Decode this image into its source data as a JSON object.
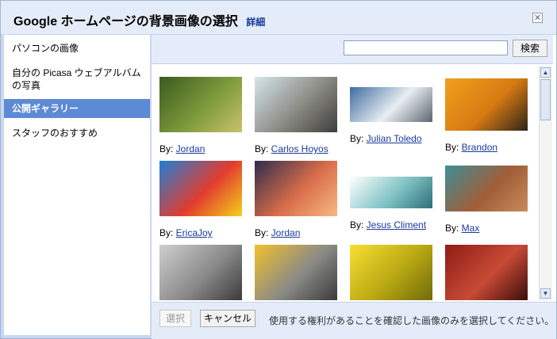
{
  "dialog": {
    "title": "Google ホームページの背景画像の選択",
    "detail_link": "詳細",
    "close_glyph": "✕"
  },
  "sidebar": {
    "items": [
      {
        "label": "パソコンの画像",
        "selected": false
      },
      {
        "label": "自分の Picasa ウェブアルバムの写真",
        "selected": false
      },
      {
        "label": "公開ギャラリー",
        "selected": true
      },
      {
        "label": "スタッフのおすすめ",
        "selected": false
      }
    ]
  },
  "search": {
    "value": "",
    "placeholder": "",
    "button_label": "検索"
  },
  "gallery": {
    "by_label": "By:",
    "photos": [
      {
        "author": "Jordan",
        "subject": "tree tunnel",
        "colors": [
          "#3b5a1f",
          "#7d9b3c",
          "#c9c26a"
        ]
      },
      {
        "author": "Carlos Hoyos",
        "subject": "plant on rock",
        "colors": [
          "#d7e6ea",
          "#8a8a84",
          "#3e3d3a"
        ]
      },
      {
        "author": "Julian Toledo",
        "subject": "snowy mountains",
        "colors": [
          "#3e6ca1",
          "#e9eef2",
          "#5b6470"
        ]
      },
      {
        "author": "Brandon",
        "subject": "city sunset",
        "colors": [
          "#f2a11c",
          "#d77a12",
          "#2b2418"
        ]
      },
      {
        "author": "EricaJoy",
        "subject": "rainbow umbrella",
        "colors": [
          "#1e7fd6",
          "#e23b2e",
          "#f4d21c"
        ]
      },
      {
        "author": "Jordan",
        "subject": "lake dusk",
        "colors": [
          "#2f2c4b",
          "#d96d4a",
          "#f7b982"
        ]
      },
      {
        "author": "Jesus Climent",
        "subject": "island",
        "colors": [
          "#ffffff",
          "#7fc3c4",
          "#2b6f77"
        ]
      },
      {
        "author": "Max",
        "subject": "weathered wood",
        "colors": [
          "#3f8f96",
          "#a15d38",
          "#c98c5a"
        ]
      },
      {
        "author": "",
        "subject": "horse mane",
        "colors": [
          "#cfcfcf",
          "#8a8a8a",
          "#3a3a3a"
        ]
      },
      {
        "author": "",
        "subject": "yellow road lines",
        "colors": [
          "#f2c12c",
          "#8a8a86",
          "#3a3a3a"
        ]
      },
      {
        "author": "",
        "subject": "yellow rose",
        "colors": [
          "#f7e034",
          "#b9a812",
          "#6e6a0c"
        ]
      },
      {
        "author": "",
        "subject": "red beans",
        "colors": [
          "#8e1c16",
          "#c74a35",
          "#3a0d0a"
        ]
      }
    ]
  },
  "footer": {
    "select_label": "選択",
    "cancel_label": "キャンセル",
    "note": "使用する権利があることを確認した画像のみを選択してください。"
  },
  "colors": {
    "title_bg": "#e5ecf9",
    "selected_bg": "#5d8ad5",
    "link": "#1a3a9c"
  },
  "scrollbar": {
    "up_glyph": "▲",
    "down_glyph": "▼"
  }
}
